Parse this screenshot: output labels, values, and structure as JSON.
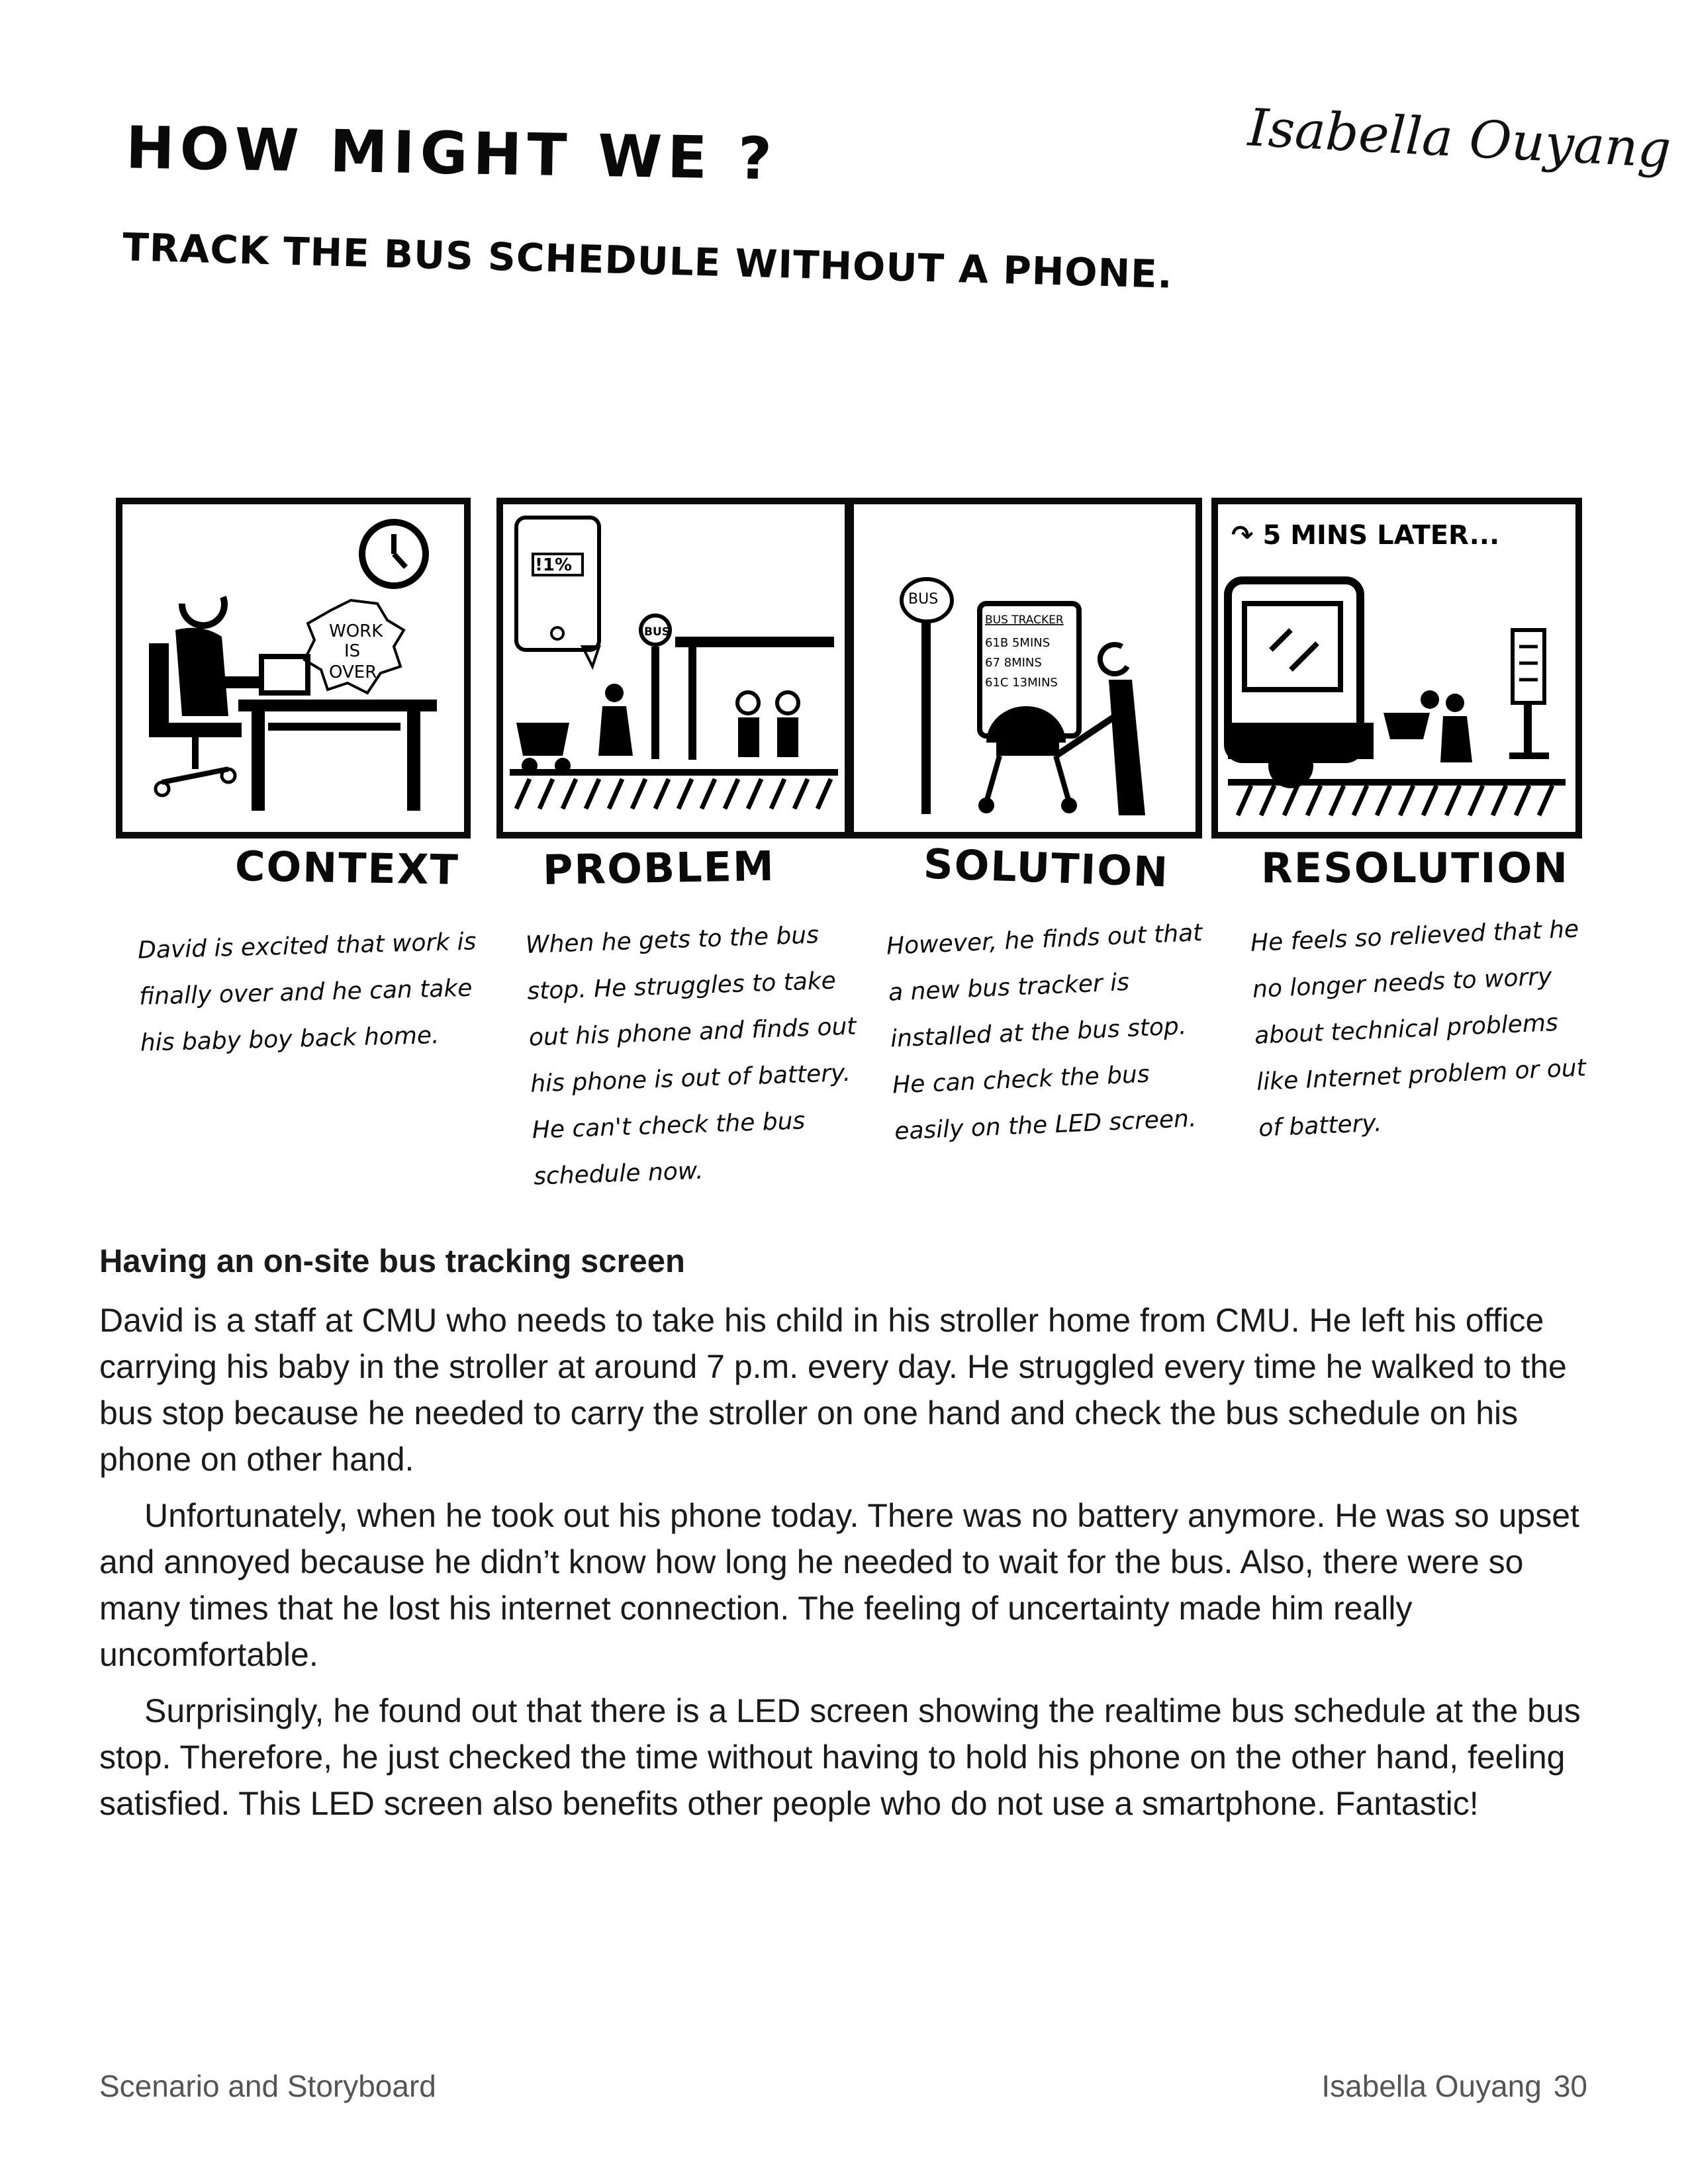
{
  "header": {
    "how_might_we": "HOW MIGHT WE ?",
    "statement": "TRACK THE BUS SCHEDULE WITHOUT A PHONE.",
    "author_signature": "Isabella Ouyang"
  },
  "storyboard": {
    "panels": [
      {
        "title": "CONTEXT",
        "caption": "David is excited that work is finally over and he can take his baby boy back home.",
        "sign_text": "WORK IS OVER"
      },
      {
        "title": "PROBLEM",
        "caption": "When he gets to the bus stop. He struggles to take out his phone and finds out his phone is out of battery. He can't check the bus schedule now.",
        "battery_text": "!1%",
        "bus_sign": "BUS"
      },
      {
        "title": "SOLUTION",
        "caption": "However, he finds out that a new bus tracker is installed at the bus stop. He can check the bus easily on the LED screen.",
        "bus_sign": "BUS",
        "tracker_title": "BUS TRACKER",
        "tracker_rows": [
          "61B  5MINS",
          "67  8MINS",
          "61C  13MINS"
        ]
      },
      {
        "title": "RESOLUTION",
        "caption": "He feels so relieved that he no longer needs to worry about technical problems like Internet problem or out of battery.",
        "time_note": "5 MINS LATER..."
      }
    ]
  },
  "article": {
    "heading": "Having an on-site bus tracking screen",
    "paragraphs": [
      "David is a staff at CMU who needs to take his child in his stroller home from CMU. He left his office carrying his baby in the stroller at around 7 p.m. every day. He struggled every time he walked to the bus stop because he needed to carry the stroller on one hand and check the bus schedule on his phone on other hand.",
      "Unfortunately, when he took out his phone today. There was no battery anymore. He was so upset and annoyed because he didn’t know how long he needed to wait for the bus. Also, there were so many times that he lost his internet connection. The feeling of uncertainty made him really uncomfortable.",
      "Surprisingly, he found out that there is a LED screen showing the realtime bus schedule at the bus stop. Therefore, he just checked the time without having to hold his phone on the other hand, feeling satisfied. This LED screen also benefits other people who do not use a smartphone. Fantastic!"
    ]
  },
  "footer": {
    "section": "Scenario and Storyboard",
    "author": "Isabella Ouyang",
    "page_number": "30"
  }
}
